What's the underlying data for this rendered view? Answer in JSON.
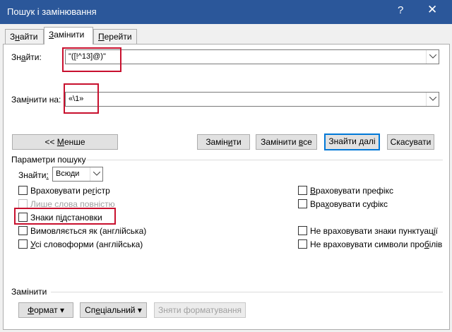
{
  "window": {
    "title": "Пошук і замінювання",
    "help": "?",
    "close": "✕"
  },
  "tabs": [
    {
      "pre": "З",
      "key": "н",
      "post": "айти"
    },
    {
      "pre": "",
      "key": "З",
      "post": "амінити"
    },
    {
      "pre": "",
      "key": "П",
      "post": "ерейти"
    }
  ],
  "find": {
    "label_pre": "Зн",
    "label_key": "а",
    "label_post": "йти:",
    "value": "\"([!^13]@)\""
  },
  "replace": {
    "label_pre": "Зам",
    "label_key": "і",
    "label_post": "нити на:",
    "value": "«\\1»"
  },
  "buttons": {
    "less": {
      "pre": "<< ",
      "key": "М",
      "post": "енше"
    },
    "replace": {
      "pre": "Замін",
      "key": "и",
      "post": "ти"
    },
    "replace_all": {
      "pre": "Замінити ",
      "key": "в",
      "post": "се"
    },
    "find_next": {
      "pre": "Знайти ",
      "key": "д",
      "post": "алі"
    },
    "cancel": {
      "pre": "",
      "key": "",
      "post": "Скасувати"
    }
  },
  "search_options": {
    "heading": "Параметри пошуку",
    "search_label_pre": "Знайти",
    "search_label_key": ":",
    "search_value": "Всюди"
  },
  "checkboxes_left": [
    {
      "pre": "Враховувати ре",
      "key": "г",
      "post": "істр"
    },
    {
      "pre": "Лише слова повні",
      "key": "с",
      "post": "тю"
    },
    {
      "pre": "Знаки п",
      "key": "і",
      "post": "дстановки"
    },
    {
      "pre": "Вимовляється як (англійська)",
      "key": "",
      "post": ""
    },
    {
      "pre": "",
      "key": "У",
      "post": "сі словоформи (англійська)"
    }
  ],
  "checkboxes_right": [
    {
      "pre": "",
      "key": "В",
      "post": "раховувати префікс"
    },
    {
      "pre": "Вра",
      "key": "х",
      "post": "овувати суфікс"
    },
    {
      "pre": "Не враховувати знаки пунктуац",
      "key": "і",
      "post": "ї"
    },
    {
      "pre": "Не враховувати символи про",
      "key": "б",
      "post": "ілів"
    }
  ],
  "replace_section": {
    "heading": "Замінити",
    "format": {
      "key": "Ф",
      "post": "ормат"
    },
    "special": {
      "pre": "Сп",
      "key": "е",
      "post": "ціальний"
    },
    "no_format": "Зняти форматування"
  }
}
